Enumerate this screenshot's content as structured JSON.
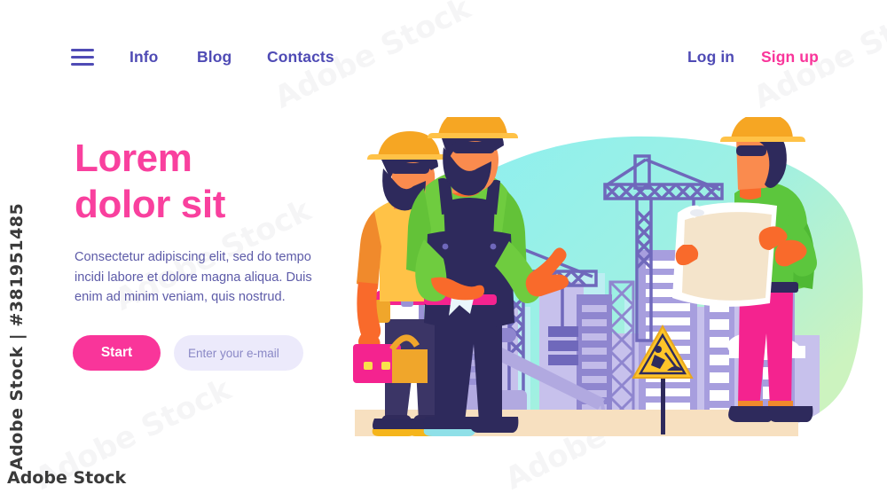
{
  "watermark": {
    "left_vertical": "Adobe Stock | #381951485",
    "bottom": "Adobe Stock",
    "tile": "Adobe Stock"
  },
  "nav": {
    "menu_icon": "hamburger-menu-icon",
    "links": [
      {
        "label": "Info"
      },
      {
        "label": "Blog"
      },
      {
        "label": "Contacts"
      }
    ],
    "login_label": "Log in",
    "signup_label": "Sign up"
  },
  "hero": {
    "headline_line1": "Lorem",
    "headline_line2": "dolor sit",
    "subcopy": "Consectetur adipiscing elit, sed do tempo incidi labore et dolore magna aliqua. Duis enim ad minim veniam, quis nostrud.",
    "start_label": "Start",
    "email_placeholder": "Enter your e-mail",
    "email_value": ""
  },
  "illustration": {
    "alt": "three construction workers in hard hats in front of a city construction site",
    "figures": [
      {
        "name": "worker-yellow-shirt",
        "shirt": "#ffc247",
        "hat": "#f6a623",
        "pants": "#3b3566",
        "toolbox": "#f4238f"
      },
      {
        "name": "worker-green-overalls",
        "shirt": "#6fcc3f",
        "overalls": "#2e2a5c",
        "hat": "#f6a623",
        "gesture": "thumbs-up"
      },
      {
        "name": "engineer-blueprint",
        "shirt": "#5cc63d",
        "pants": "#f4238f",
        "hat": "#f6a623",
        "holding": "blueprint"
      }
    ],
    "scene": {
      "sky_blob": "#8ceff0",
      "sky_blob_end": "#c9f2c2",
      "ground": "#f7e0c0",
      "buildings": "#9a92d6",
      "buildings_light": "#c7c1ec",
      "cranes": "#6f68bb",
      "sign": "construction-work-sign",
      "sign_color": "#ffc529"
    },
    "colors": {
      "pink": "#f9359a",
      "purple": "#4f4bb5",
      "cyan": "#8ceff0",
      "orange": "#f96a2b",
      "green": "#6fcc3f",
      "navy": "#2e2a5c"
    }
  }
}
